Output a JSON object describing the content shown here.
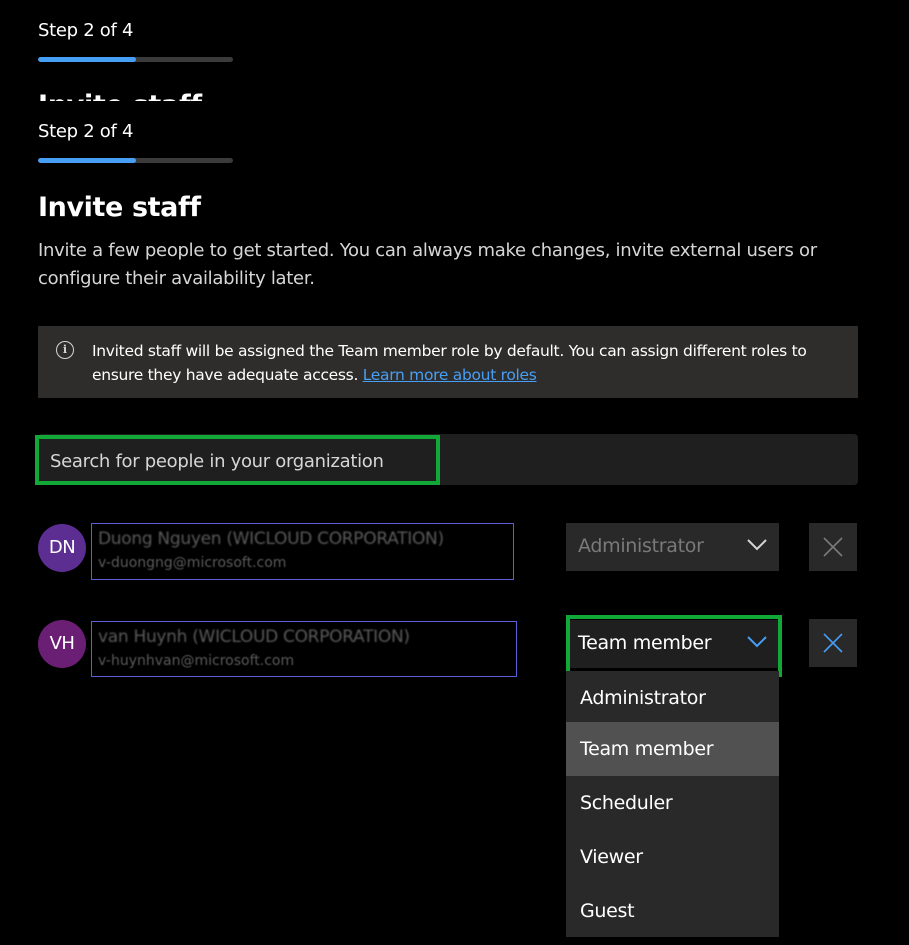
{
  "wizard": {
    "step_label": "Step 2 of 4",
    "progress_fraction": 0.5,
    "ghost_title": "Invite staff"
  },
  "page": {
    "title": "Invite staff",
    "description": "Invite a few people to get started. You can always make changes, invite external users or configure their availability later."
  },
  "info": {
    "text": "Invited staff will be assigned the Team member role by default. You can assign different roles to ensure they have adequate access. ",
    "link": "Learn more about roles",
    "icon": "info-icon"
  },
  "search": {
    "placeholder": "Search for people in your organization"
  },
  "staff": [
    {
      "initials": "DN",
      "avatar_color": "#5c2e91",
      "name": "Duong Nguyen (WICLOUD CORPORATION)",
      "email": "v-duongng@microsoft.com",
      "role": "Administrator"
    },
    {
      "initials": "VH",
      "avatar_color": "#6b1f74",
      "name": "van Huynh (WICLOUD CORPORATION)",
      "email": "v-huynhvan@microsoft.com",
      "role": "Team member"
    }
  ],
  "role_options": [
    "Administrator",
    "Team member",
    "Scheduler",
    "Viewer",
    "Guest"
  ],
  "selected_role_index": 1,
  "colors": {
    "accent": "#479ef5",
    "highlight": "#12a838",
    "background": "#000000",
    "surface": "#292929"
  }
}
